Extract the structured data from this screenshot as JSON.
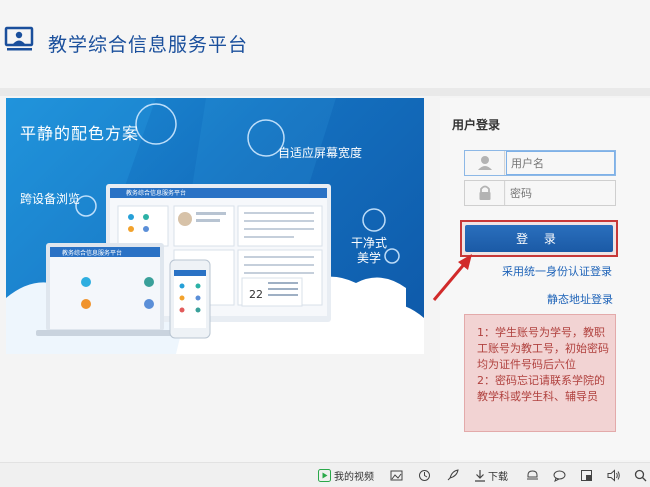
{
  "header": {
    "title": "教学综合信息服务平台"
  },
  "banner": {
    "slogan1": "平静的配色方案",
    "slogan2": "自适应屏幕宽度",
    "slogan3": "跨设备浏览",
    "slogan4": "干净式美学",
    "monitor_title": "教务综合信息服务平台",
    "laptop_title": "教务综合信息服务平台",
    "calendar_day": "22"
  },
  "login": {
    "title": "用户登录",
    "username_placeholder": "用户名",
    "password_placeholder": "密码",
    "login_button": "登 录",
    "unified_login_link": "采用统一身份认证登录",
    "static_login_link": "静态地址登录",
    "notice": "1：学生账号为学号，教职工账号为教工号，初始密码均为证件号码后六位\n2：密码忘记请联系学院的教学科或学生科、辅导员"
  },
  "toolbar": {
    "my_video": "我的视频",
    "download": "下载"
  },
  "colors": {
    "brand": "#1a4f9c",
    "button": "#1b5aa6",
    "notice_bg": "#f2d3d3",
    "notice_text": "#b0413e",
    "highlight": "#c73838"
  }
}
